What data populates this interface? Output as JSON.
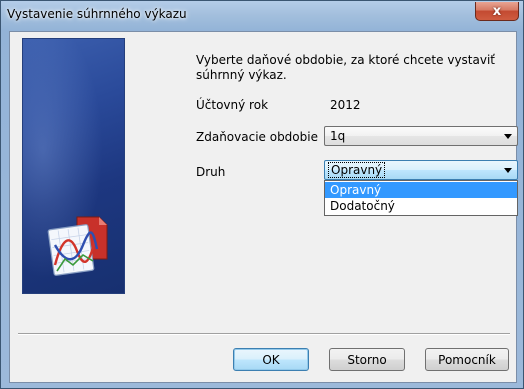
{
  "window": {
    "title": "Vystavenie súhrnného výkazu",
    "close_label": "x"
  },
  "form": {
    "instruction": "Vyberte daňové obdobie, za ktoré chcete vystaviť súhrnný výkaz.",
    "year_label": "Účtovný rok",
    "year_value": "2012",
    "period_label": "Zdaňovacie obdobie",
    "period_value": "1q",
    "type_label": "Druh",
    "type_value": "Opravný",
    "type_options": [
      "Opravný",
      "Dodatočný"
    ]
  },
  "buttons": {
    "ok": "OK",
    "cancel": "Storno",
    "help": "Pomocník"
  },
  "colors": {
    "selection": "#3399ff",
    "side_panel": "#1d3780"
  },
  "icons": {
    "side_panel": "chart-document-icon"
  }
}
